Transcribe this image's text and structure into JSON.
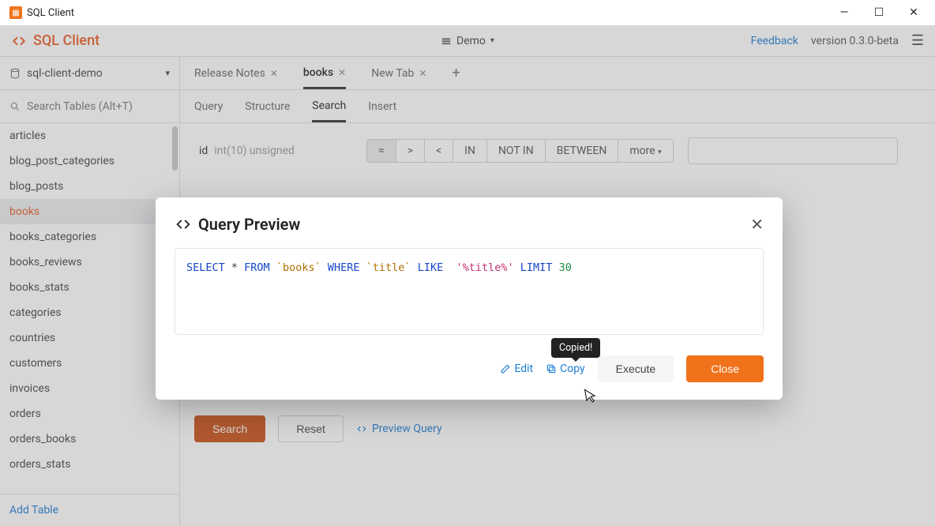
{
  "titlebar": {
    "app_name": "SQL Client"
  },
  "header": {
    "brand": "SQL Client",
    "workspace_label": "Demo",
    "feedback": "Feedback",
    "version": "version 0.3.0-beta"
  },
  "sidebar": {
    "database": "sql-client-demo",
    "search_placeholder": "Search Tables (Alt+T)",
    "tables": [
      "articles",
      "blog_post_categories",
      "blog_posts",
      "books",
      "books_categories",
      "books_reviews",
      "books_stats",
      "categories",
      "countries",
      "customers",
      "invoices",
      "orders",
      "orders_books",
      "orders_stats"
    ],
    "active_table": "books",
    "add_table": "Add Table"
  },
  "tabs": {
    "items": [
      {
        "label": "Release Notes",
        "closable": true,
        "active": false
      },
      {
        "label": "books",
        "closable": true,
        "active": true
      },
      {
        "label": "New Tab",
        "closable": true,
        "active": false
      }
    ]
  },
  "subtabs": {
    "items": [
      "Query",
      "Structure",
      "Search",
      "Insert"
    ],
    "active": "Search"
  },
  "search": {
    "field": {
      "name": "id",
      "type": "int(10) unsigned"
    },
    "operators": [
      "=",
      ">",
      "<",
      "IN",
      "NOT IN",
      "BETWEEN"
    ],
    "more_label": "more",
    "active_op": "="
  },
  "action_bar": {
    "search_btn": "Search",
    "reset_btn": "Reset",
    "preview_link": "Preview Query"
  },
  "modal": {
    "title": "Query Preview",
    "sql_tokens": [
      {
        "t": "SELECT",
        "c": "kw"
      },
      {
        "t": " * ",
        "c": ""
      },
      {
        "t": "FROM",
        "c": "kw"
      },
      {
        "t": " ",
        "c": ""
      },
      {
        "t": "`books`",
        "c": "id"
      },
      {
        "t": " ",
        "c": ""
      },
      {
        "t": "WHERE",
        "c": "kw"
      },
      {
        "t": " ",
        "c": ""
      },
      {
        "t": "`title`",
        "c": "id"
      },
      {
        "t": " ",
        "c": ""
      },
      {
        "t": "LIKE",
        "c": "kw"
      },
      {
        "t": "  ",
        "c": ""
      },
      {
        "t": "'%title%'",
        "c": "str"
      },
      {
        "t": " ",
        "c": ""
      },
      {
        "t": "LIMIT",
        "c": "kw"
      },
      {
        "t": " ",
        "c": ""
      },
      {
        "t": "30",
        "c": "num"
      }
    ],
    "edit_btn": "Edit",
    "copy_btn": "Copy",
    "execute_btn": "Execute",
    "close_btn": "Close",
    "tooltip": "Copied!"
  }
}
